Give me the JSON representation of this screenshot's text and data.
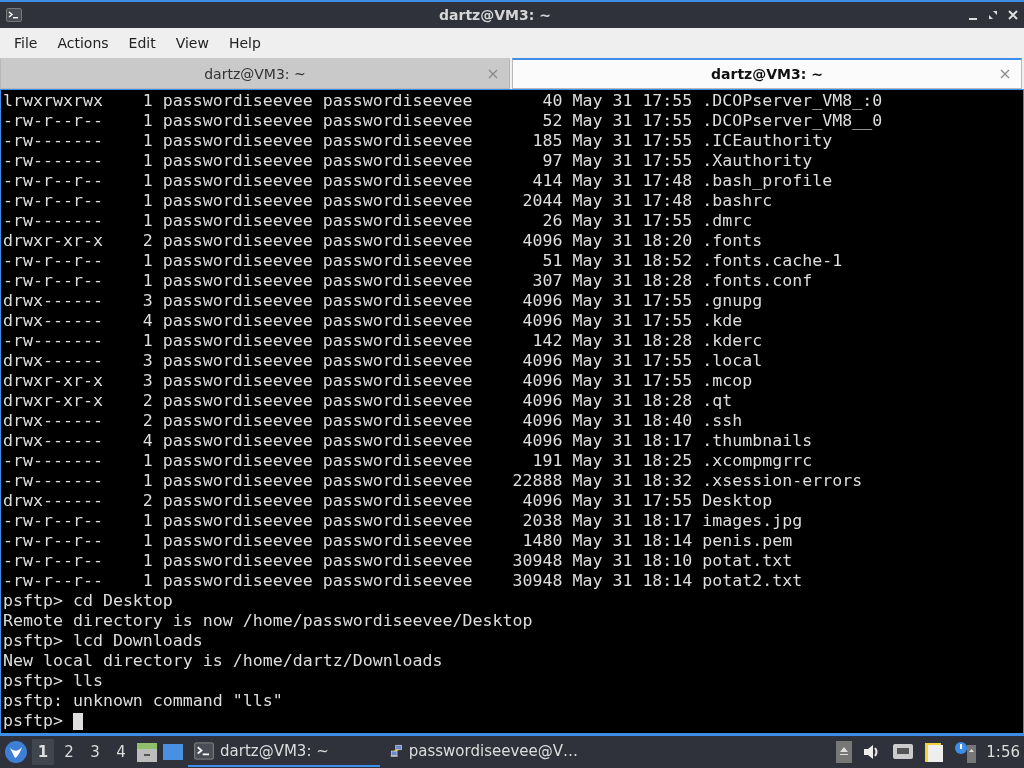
{
  "window": {
    "title": "dartz@VM3: ~"
  },
  "menu": [
    "File",
    "Actions",
    "Edit",
    "View",
    "Help"
  ],
  "tabs": [
    {
      "label": "dartz@VM3: ~",
      "selected": false
    },
    {
      "label": "dartz@VM3: ~",
      "selected": true
    }
  ],
  "terminal": {
    "lines": [
      "lrwxrwxrwx    1 passwordiseevee passwordiseevee       40 May 31 17:55 .DCOPserver_VM8_:0",
      "-rw-r--r--    1 passwordiseevee passwordiseevee       52 May 31 17:55 .DCOPserver_VM8__0",
      "-rw-------    1 passwordiseevee passwordiseevee      185 May 31 17:55 .ICEauthority",
      "-rw-------    1 passwordiseevee passwordiseevee       97 May 31 17:55 .Xauthority",
      "-rw-r--r--    1 passwordiseevee passwordiseevee      414 May 31 17:48 .bash_profile",
      "-rw-r--r--    1 passwordiseevee passwordiseevee     2044 May 31 17:48 .bashrc",
      "-rw-------    1 passwordiseevee passwordiseevee       26 May 31 17:55 .dmrc",
      "drwxr-xr-x    2 passwordiseevee passwordiseevee     4096 May 31 18:20 .fonts",
      "-rw-r--r--    1 passwordiseevee passwordiseevee       51 May 31 18:52 .fonts.cache-1",
      "-rw-r--r--    1 passwordiseevee passwordiseevee      307 May 31 18:28 .fonts.conf",
      "drwx------    3 passwordiseevee passwordiseevee     4096 May 31 17:55 .gnupg",
      "drwx------    4 passwordiseevee passwordiseevee     4096 May 31 17:55 .kde",
      "-rw-------    1 passwordiseevee passwordiseevee      142 May 31 18:28 .kderc",
      "drwx------    3 passwordiseevee passwordiseevee     4096 May 31 17:55 .local",
      "drwxr-xr-x    3 passwordiseevee passwordiseevee     4096 May 31 17:55 .mcop",
      "drwxr-xr-x    2 passwordiseevee passwordiseevee     4096 May 31 18:28 .qt",
      "drwx------    2 passwordiseevee passwordiseevee     4096 May 31 18:40 .ssh",
      "drwx------    4 passwordiseevee passwordiseevee     4096 May 31 18:17 .thumbnails",
      "-rw-------    1 passwordiseevee passwordiseevee      191 May 31 18:25 .xcompmgrrc",
      "-rw-------    1 passwordiseevee passwordiseevee    22888 May 31 18:32 .xsession-errors",
      "drwx------    2 passwordiseevee passwordiseevee     4096 May 31 17:55 Desktop",
      "-rw-r--r--    1 passwordiseevee passwordiseevee     2038 May 31 18:17 images.jpg",
      "-rw-r--r--    1 passwordiseevee passwordiseevee     1480 May 31 18:14 penis.pem",
      "-rw-r--r--    1 passwordiseevee passwordiseevee    30948 May 31 18:10 potat.txt",
      "-rw-r--r--    1 passwordiseevee passwordiseevee    30948 May 31 18:14 potat2.txt",
      "psftp> cd Desktop",
      "Remote directory is now /home/passwordiseevee/Desktop",
      "psftp> lcd Downloads",
      "New local directory is /home/dartz/Downloads",
      "psftp> lls",
      "psftp: unknown command \"lls\""
    ],
    "prompt": "psftp>"
  },
  "taskbar": {
    "workspaces": [
      {
        "label": "1",
        "selected": true
      },
      {
        "label": "2",
        "selected": false
      },
      {
        "label": "3",
        "selected": false
      },
      {
        "label": "4",
        "selected": false
      }
    ],
    "tasks": [
      {
        "kind": "terminal",
        "label": "dartz@VM3: ~",
        "selected": true
      },
      {
        "kind": "network",
        "label": "passwordiseevee@V…",
        "selected": false
      }
    ],
    "clock": "1:56"
  }
}
